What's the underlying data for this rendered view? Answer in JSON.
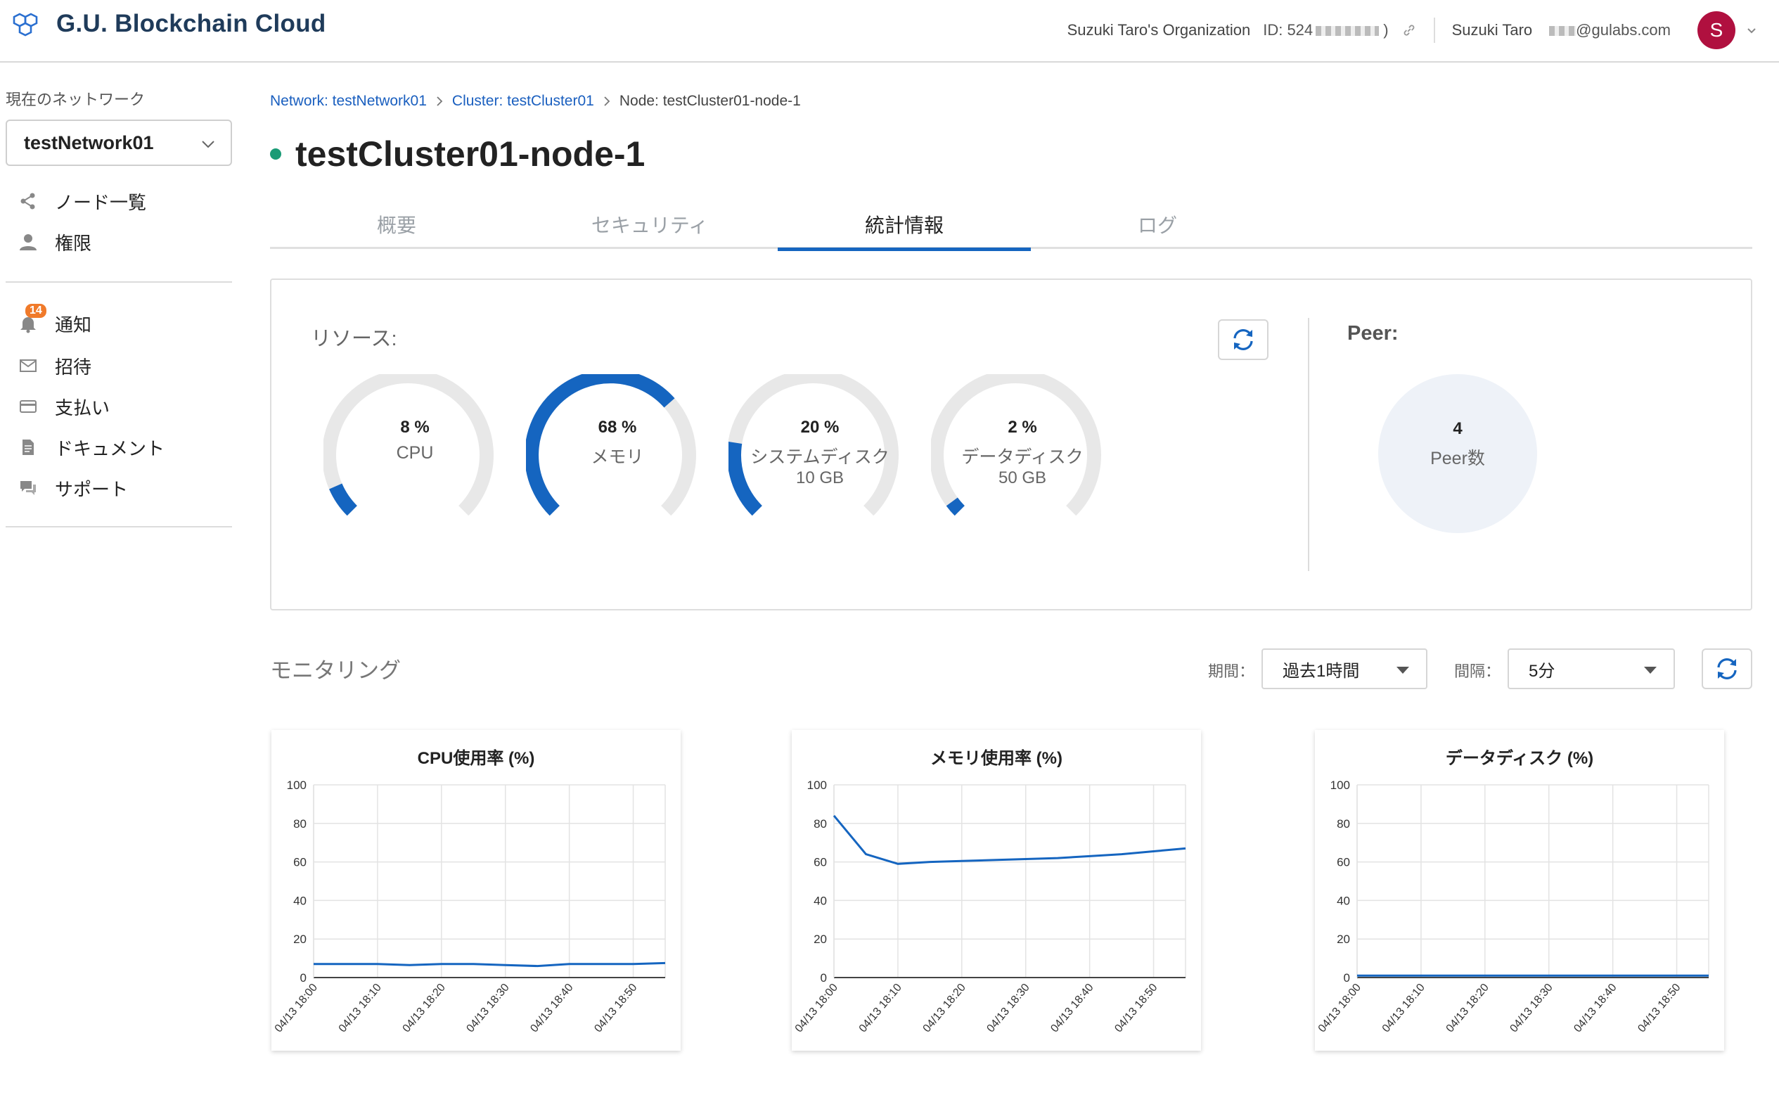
{
  "header": {
    "app_title": "G.U. Blockchain Cloud",
    "org_name": "Suzuki Taro's Organization",
    "id_label": "ID: 524",
    "id_suffix": ")",
    "user_name": "Suzuki Taro",
    "email_visible": "@gulabs.com",
    "avatar_initial": "S"
  },
  "sidebar": {
    "current_network_label": "現在のネットワーク",
    "network_select_value": "testNetwork01",
    "items_top": [
      {
        "label": "ノード一覧",
        "icon": "share-icon"
      },
      {
        "label": "権限",
        "icon": "user-icon"
      }
    ],
    "items_bottom": [
      {
        "label": "通知",
        "icon": "bell-icon",
        "badge": "14"
      },
      {
        "label": "招待",
        "icon": "mail-icon"
      },
      {
        "label": "支払い",
        "icon": "credit-card-icon"
      },
      {
        "label": "ドキュメント",
        "icon": "document-icon"
      },
      {
        "label": "サポート",
        "icon": "chat-icon"
      }
    ]
  },
  "breadcrumb": {
    "network": "Network: testNetwork01",
    "cluster": "Cluster: testCluster01",
    "node": "Node: testCluster01-node-1"
  },
  "page_title": "testCluster01-node-1",
  "colors": {
    "accent": "#1565c0",
    "status_ok": "#1a9b76",
    "gauge_track": "#e8e8e8",
    "badge": "#f07a2a",
    "avatar": "#b0103f"
  },
  "tabs": [
    {
      "label": "概要",
      "active": false
    },
    {
      "label": "セキュリティ",
      "active": false
    },
    {
      "label": "統計情報",
      "active": true
    },
    {
      "label": "ログ",
      "active": false
    }
  ],
  "resources": {
    "label": "リソース:",
    "gauges": [
      {
        "percent_label": "8 %",
        "value": 8,
        "name": "CPU",
        "size": ""
      },
      {
        "percent_label": "68 %",
        "value": 68,
        "name": "メモリ",
        "size": ""
      },
      {
        "percent_label": "20 %",
        "value": 20,
        "name": "システムディスク",
        "size": "10 GB"
      },
      {
        "percent_label": "2 %",
        "value": 2,
        "name": "データディスク",
        "size": "50 GB"
      }
    ],
    "peer_label": "Peer:",
    "peer_count": "4",
    "peer_count_label": "Peer数"
  },
  "monitoring": {
    "title": "モニタリング",
    "period_label": "期間：",
    "period_value": "過去1時間",
    "interval_label": "間隔：",
    "interval_value": "5分"
  },
  "chart_data": [
    {
      "type": "line",
      "title": "CPU使用率 (%)",
      "x": [
        "04/13 18:00",
        "04/13 18:05",
        "04/13 18:10",
        "04/13 18:15",
        "04/13 18:20",
        "04/13 18:25",
        "04/13 18:30",
        "04/13 18:35",
        "04/13 18:40",
        "04/13 18:45",
        "04/13 18:50",
        "04/13 18:55"
      ],
      "x_tick_labels": [
        "04/13 18:00",
        "04/13 18:10",
        "04/13 18:20",
        "04/13 18:30",
        "04/13 18:40",
        "04/13 18:50"
      ],
      "y_ticks": [
        "100",
        "80",
        "60",
        "40",
        "20",
        "0"
      ],
      "values": [
        7,
        7,
        7,
        6.5,
        7,
        7,
        6.5,
        6,
        7,
        7,
        7,
        7.5
      ],
      "ylim": [
        0,
        100
      ],
      "grid": true
    },
    {
      "type": "line",
      "title": "メモリ使用率 (%)",
      "x": [
        "04/13 18:00",
        "04/13 18:05",
        "04/13 18:10",
        "04/13 18:15",
        "04/13 18:20",
        "04/13 18:25",
        "04/13 18:30",
        "04/13 18:35",
        "04/13 18:40",
        "04/13 18:45",
        "04/13 18:50",
        "04/13 18:55"
      ],
      "x_tick_labels": [
        "04/13 18:00",
        "04/13 18:10",
        "04/13 18:20",
        "04/13 18:30",
        "04/13 18:40",
        "04/13 18:50"
      ],
      "y_ticks": [
        "100",
        "80",
        "60",
        "40",
        "20",
        "0"
      ],
      "values": [
        84,
        64,
        59,
        60,
        60.5,
        61,
        61.5,
        62,
        63,
        64,
        65.5,
        67
      ],
      "ylim": [
        0,
        100
      ],
      "grid": true
    },
    {
      "type": "line",
      "title": "データディスク (%)",
      "x": [
        "04/13 18:00",
        "04/13 18:05",
        "04/13 18:10",
        "04/13 18:15",
        "04/13 18:20",
        "04/13 18:25",
        "04/13 18:30",
        "04/13 18:35",
        "04/13 18:40",
        "04/13 18:45",
        "04/13 18:50",
        "04/13 18:55"
      ],
      "x_tick_labels": [
        "04/13 18:00",
        "04/13 18:10",
        "04/13 18:20",
        "04/13 18:30",
        "04/13 18:40",
        "04/13 18:50"
      ],
      "y_ticks": [
        "100",
        "80",
        "60",
        "40",
        "20",
        "0"
      ],
      "values": [
        1,
        1,
        1,
        1,
        1,
        1,
        1,
        1,
        1,
        1,
        1,
        1
      ],
      "ylim": [
        0,
        100
      ],
      "grid": true
    }
  ]
}
